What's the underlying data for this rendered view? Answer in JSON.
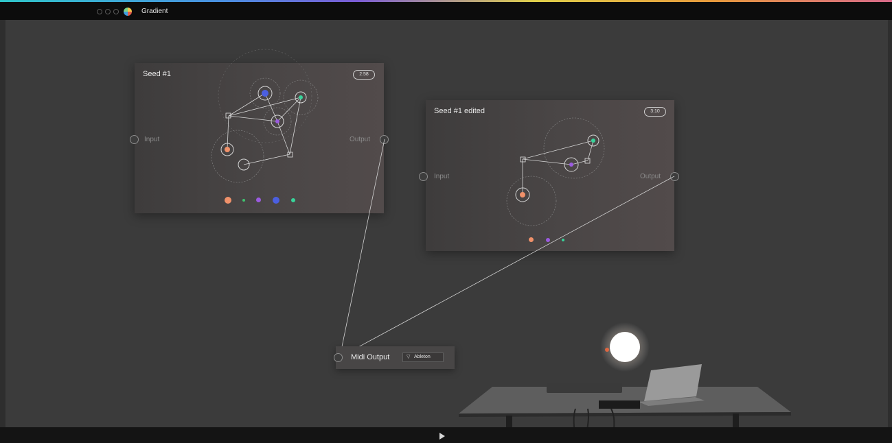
{
  "app": {
    "title": "Gradient",
    "window_controls": [
      "close",
      "minimize",
      "zoom"
    ],
    "logo_icon": "gradient-logo-icon"
  },
  "nodes": [
    {
      "id": "seed-1",
      "title": "Seed #1",
      "badge": "2:58",
      "input_label": "Input",
      "output_label": "Output",
      "sequence_colors": [
        "#f0916a",
        "#3fc26f",
        "#9b5be0",
        "#4b5fe0",
        "#38d39a"
      ]
    },
    {
      "id": "seed-1-edited",
      "title": "Seed #1 edited",
      "badge": "3:10",
      "input_label": "Input",
      "output_label": "Output",
      "sequence_colors": [
        "#f0916a",
        "#9b5be0",
        "#38d39a"
      ]
    }
  ],
  "midi_output": {
    "label": "Midi Output",
    "selected": "Ableton",
    "caret_icon": "triangle-down-icon"
  },
  "transport": {
    "play_icon": "play-icon"
  },
  "colors": {
    "background": "#3b3b3b",
    "titlebar": "#0c0c0c",
    "node": "#484545",
    "orange": "#f0916a",
    "purple": "#9b5be0",
    "blue": "#4b5fe0",
    "teal": "#38d39a",
    "green": "#3fc26f"
  }
}
